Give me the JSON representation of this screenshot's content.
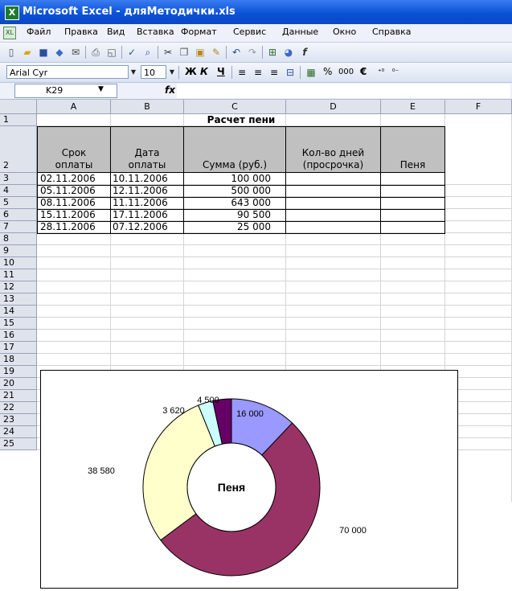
{
  "window": {
    "title": "Microsoft Excel - дляМетодички.xls"
  },
  "menu": [
    "Файл",
    "Правка",
    "Вид",
    "Вставка",
    "Формат",
    "Сервис",
    "Данные",
    "Окно",
    "Справка"
  ],
  "format_toolbar": {
    "font": "Arial Cyr",
    "size": "10",
    "bold": "Ж",
    "italic": "К",
    "underline": "Ч",
    "percent": "%",
    "thousands": "000",
    "currency": "€"
  },
  "formula_bar": {
    "cell_ref": "K29",
    "fx": "fx",
    "content": ""
  },
  "columns": [
    "A",
    "B",
    "C",
    "D",
    "E",
    "F"
  ],
  "rows": [
    "1",
    "2",
    "3",
    "4",
    "5",
    "6",
    "7",
    "8",
    "9",
    "10",
    "11",
    "12",
    "13",
    "14",
    "15",
    "16",
    "17",
    "18",
    "19",
    "20",
    "21",
    "22",
    "23",
    "24",
    "25"
  ],
  "sheet": {
    "title": "Расчет пени",
    "headers": [
      {
        "line1": "Срок",
        "line2": "оплаты"
      },
      {
        "line1": "Дата",
        "line2": "оплаты"
      },
      {
        "line1": "",
        "line2": "Сумма (руб.)"
      },
      {
        "line1": "Кол-во дней",
        "line2": "(просрочка)"
      },
      {
        "line1": "",
        "line2": "Пеня"
      }
    ],
    "data": [
      [
        "02.11.2006",
        "10.11.2006",
        "100 000"
      ],
      [
        "05.11.2006",
        "12.11.2006",
        "500 000"
      ],
      [
        "08.11.2006",
        "11.11.2006",
        "643 000"
      ],
      [
        "15.11.2006",
        "17.11.2006",
        "90 500"
      ],
      [
        "28.11.2006",
        "07.12.2006",
        "25 000"
      ]
    ]
  },
  "chart_data": {
    "type": "pie",
    "title": "Пеня",
    "labels": [
      "16 000",
      "70 000",
      "38 580",
      "3 620",
      "4 500"
    ],
    "values": [
      16000,
      70000,
      38580,
      3620,
      4500
    ],
    "colors": [
      "#9999ff",
      "#993366",
      "#ffffcc",
      "#ccffff",
      "#660066"
    ]
  }
}
